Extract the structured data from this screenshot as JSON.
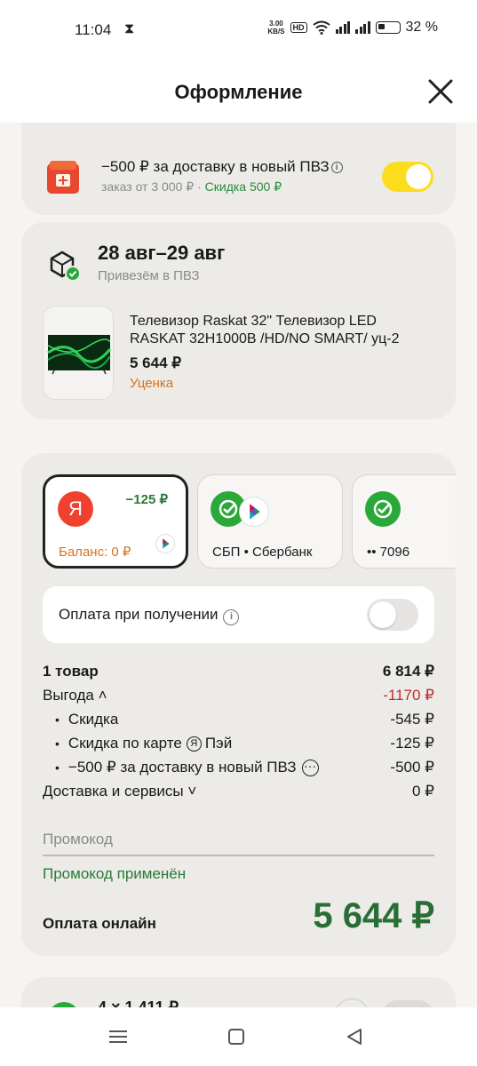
{
  "status_bar": {
    "time": "11:04",
    "speed_top": "3.00",
    "speed_bottom": "KB/S",
    "hd": "HD",
    "battery": "32 %"
  },
  "header": {
    "title": "Оформление"
  },
  "promo": {
    "title": "−500 ₽ за доставку в новый ПВЗ",
    "subtitle": "заказ от 3 000 ₽ ·",
    "discount": "Скидка 500 ₽",
    "toggle_on": true
  },
  "delivery": {
    "date": "28 авг–29 авг",
    "subtitle": "Привезём в ПВЗ",
    "product": {
      "name": "Телевизор Raskat 32\" Телевизор LED RASKAT 32H1000B /HD/NO SMART/ уц-2",
      "price": "5 644 ₽",
      "tag": "Уценка"
    }
  },
  "payment": {
    "methods": [
      {
        "logo": "Я",
        "cashback": "−125 ₽",
        "label": "Баланс: 0 ₽",
        "selected": true
      },
      {
        "label": "СБП • Сбербанк",
        "selected": false
      },
      {
        "label": "•• 7096",
        "selected": false
      }
    ],
    "cod": {
      "label": "Оплата при получении",
      "toggle_on": false
    },
    "summary": {
      "items_label": "1 товар",
      "items_value": "6 814 ₽",
      "benefit_label": "Выгода ˄",
      "benefit_value": "-1170 ₽",
      "discount_label": "Скидка",
      "discount_value": "-545 ₽",
      "card_discount_label_pre": "Скидка по карте",
      "card_discount_logo": "Я",
      "card_discount_label_post": "Пэй",
      "card_discount_value": "-125 ₽",
      "pickup_discount_label": "−500 ₽ за доставку в новый ПВЗ",
      "pickup_discount_value": "-500 ₽",
      "delivery_label": "Доставка и сервисы ˅",
      "delivery_value": "0 ₽"
    },
    "promo_placeholder": "Промокод",
    "promo_applied": "Промокод применён",
    "online_label": "Оплата онлайн",
    "total": "5 644 ₽"
  },
  "bottom_card": {
    "text": "4 × 1 411 ₽"
  },
  "colors": {
    "accent_yellow": "#fcdd1e",
    "green": "#2a7a36",
    "orange": "#d5731e",
    "red": "#c42a2a"
  }
}
